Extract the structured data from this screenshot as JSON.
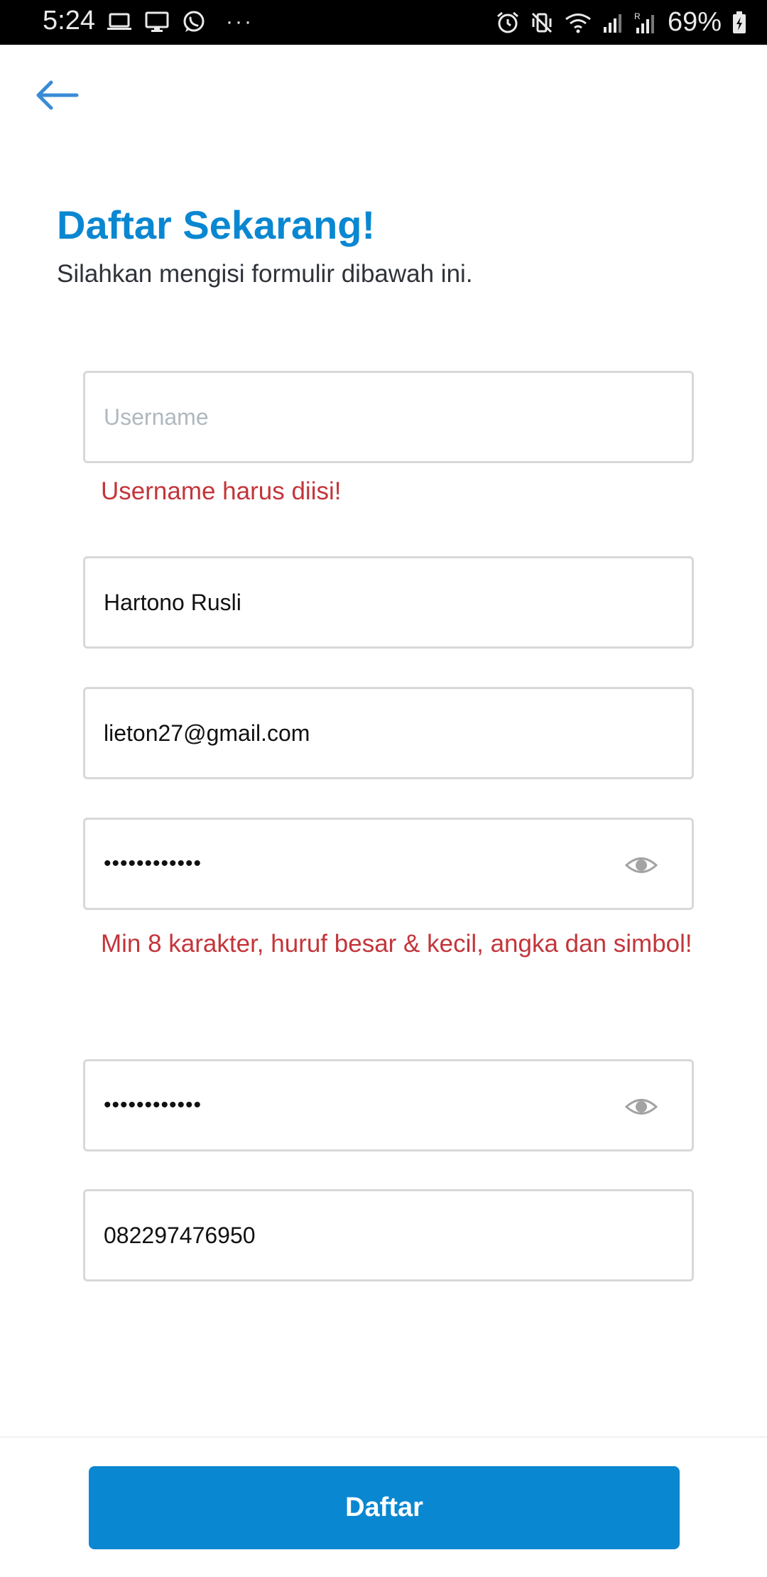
{
  "status_bar": {
    "time": "5:24",
    "battery_percent": "69%",
    "more_indicator": "···",
    "icons_left": [
      "laptop-icon",
      "monitor-icon",
      "whatsapp-icon"
    ],
    "icons_right": [
      "alarm-icon",
      "vibrate-icon",
      "wifi-icon",
      "signal-icon",
      "roaming-signal-icon",
      "battery-charging-icon"
    ],
    "roaming_letter": "R"
  },
  "header": {
    "back_icon": "arrow-left-icon",
    "title": "Daftar Sekarang!",
    "subtitle": "Silahkan mengisi formulir dibawah ini."
  },
  "form": {
    "username": {
      "value": "",
      "placeholder": "Username",
      "error": "Username harus diisi!"
    },
    "fullname": {
      "value": "Hartono Rusli"
    },
    "email": {
      "value": "lieton27@gmail.com"
    },
    "password": {
      "value": "••••••••••••",
      "error": "Min 8 karakter, huruf besar & kecil, angka dan simbol!",
      "toggle_icon": "eye-icon"
    },
    "confirm_password": {
      "value": "••••••••••••",
      "toggle_icon": "eye-icon"
    },
    "phone": {
      "value": "082297476950"
    }
  },
  "footer": {
    "submit_label": "Daftar"
  },
  "colors": {
    "accent": "#0a87d1",
    "error": "#c3353a",
    "border": "#d8d8d8",
    "placeholder": "#b0b8bf"
  }
}
